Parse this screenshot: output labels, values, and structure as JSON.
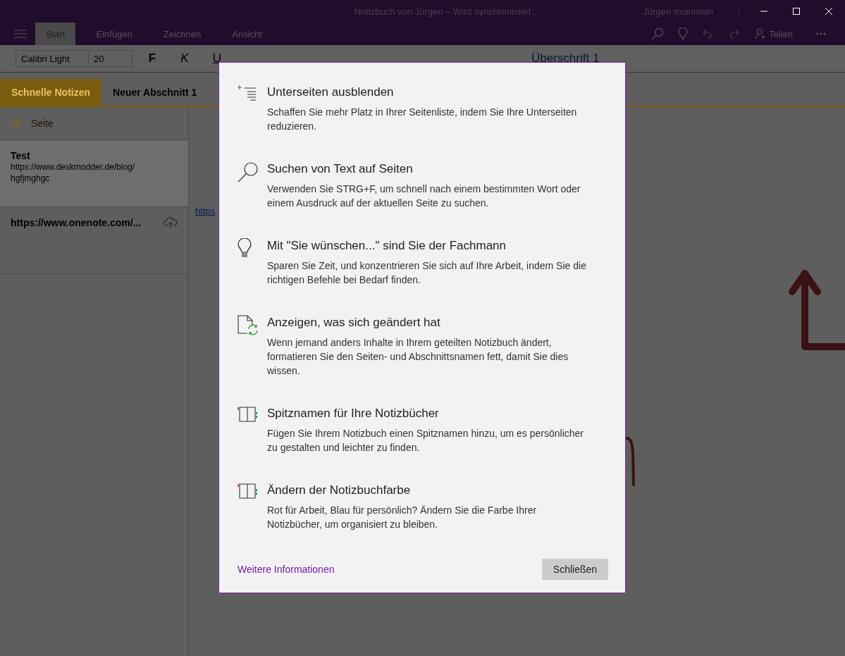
{
  "window": {
    "title": "Notizbuch von Jürgen – Wird synchronisiert…",
    "user": "Jürgen moinmoin"
  },
  "ribbon_tabs": [
    {
      "label": "Start",
      "selected": true
    },
    {
      "label": "Einfügen",
      "selected": false
    },
    {
      "label": "Zeichnen",
      "selected": false
    },
    {
      "label": "Ansicht",
      "selected": false
    }
  ],
  "share_button": "Teilen",
  "toolbar": {
    "font": "Calibri Light",
    "size": "20",
    "bold": "F",
    "italic": "K",
    "underline": "U",
    "style": "Überschrift 1"
  },
  "sections": [
    {
      "label": "Schnelle Notizen",
      "selected": true
    },
    {
      "label": "Neuer Abschnitt 1",
      "selected": false
    }
  ],
  "add_page": "Seite",
  "pages": [
    {
      "title": "Test",
      "preview_lines": [
        "https://www.deskmodder.de/blog/",
        "hgfjmghgc"
      ],
      "selected": true,
      "uploading": false
    },
    {
      "title": "https://www.onenote.com/...",
      "selected": false,
      "uploading": true
    }
  ],
  "page_content": {
    "link": "https"
  },
  "dialog": {
    "items": [
      {
        "kind": "subpages",
        "title": "Unterseiten ausblenden",
        "text_lines": [
          "Schaffen Sie mehr Platz in Ihrer Seitenliste, indem Sie Ihre Unterseiten",
          "reduzieren."
        ]
      },
      {
        "kind": "search",
        "title": "Suchen von Text auf Seiten",
        "text_lines": [
          "Verwenden Sie STRG+F, um schnell nach einem bestimmten Wort oder",
          "einem Ausdruck auf der aktuellen Seite zu suchen."
        ]
      },
      {
        "kind": "bulb",
        "title": "Mit \"Sie wünschen...\" sind Sie der Fachmann",
        "text_lines": [
          "Sparen Sie Zeit, und konzentrieren Sie sich auf Ihre Arbeit, indem Sie die",
          "richtigen Befehle bei Bedarf finden."
        ]
      },
      {
        "kind": "changes",
        "title": "Anzeigen, was sich geändert hat",
        "text_lines": [
          "Wenn jemand anders Inhalte in Ihrem geteilten Notizbuch ändert,",
          "formatieren Sie den Seiten- und Abschnittsnamen fett, damit Sie dies",
          "wissen."
        ]
      },
      {
        "kind": "notebook",
        "title": "Spitznamen für Ihre Notizbücher",
        "text_lines": [
          "Fügen Sie Ihrem Notizbuch einen Spitznamen hinzu, um es persönlicher",
          "zu gestalten und leichter zu finden."
        ]
      },
      {
        "kind": "notebook",
        "title": "Ändern der Notizbuchfarbe",
        "text_lines": [
          "Rot für Arbeit, Blau für persönlich? Ändern Sie die Farbe Ihrer",
          "Notizbücher, um organisiert zu bleiben."
        ]
      }
    ],
    "link": "Weitere Informationen",
    "button": "Schließen"
  }
}
